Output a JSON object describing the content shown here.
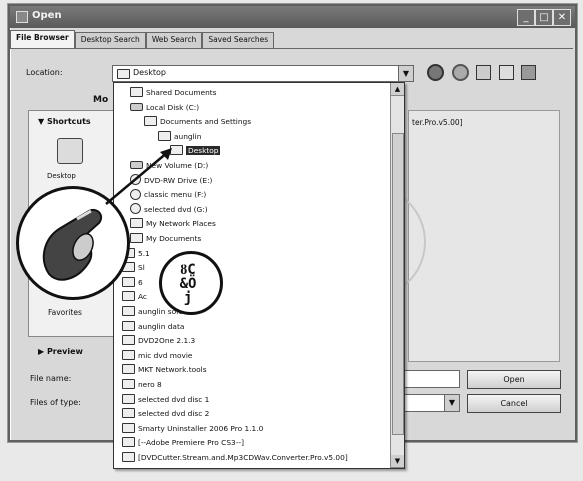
{
  "window": {
    "title": "Open",
    "buttons": [
      "minimize",
      "maximize",
      "close"
    ]
  },
  "tabs": [
    {
      "label": "File Browser",
      "active": true
    },
    {
      "label": "Desktop Search",
      "active": false
    },
    {
      "label": "Web Search",
      "active": false
    },
    {
      "label": "Saved Searches",
      "active": false
    }
  ],
  "location": {
    "label": "Location:",
    "value": "Desktop"
  },
  "left_pane": {
    "mode_label": "Mo",
    "shortcuts_header": "Shortcuts",
    "desktop_label": "Desktop",
    "favorites_label": "Favorites",
    "preview_header": "Preview"
  },
  "right_pane": {
    "partial_text": "ter.Pro.v5.00]"
  },
  "bottom": {
    "filename_label": "File name:",
    "filetype_label": "Files of type:",
    "open_button": "Open",
    "cancel_button": "Cancel"
  },
  "dropdown": {
    "items": [
      {
        "label": "Shared Documents",
        "icon": "folder-icon",
        "indent": 1,
        "selected": false
      },
      {
        "label": "Local Disk (C:)",
        "icon": "drive-icon",
        "indent": 1,
        "selected": false
      },
      {
        "label": "Documents and Settings",
        "icon": "folder-icon",
        "indent": 2,
        "selected": false
      },
      {
        "label": "aunglin",
        "icon": "folder-icon",
        "indent": 3,
        "selected": false
      },
      {
        "label": "Desktop",
        "icon": "folder-icon",
        "indent": 4,
        "selected": true
      },
      {
        "label": "New Volume (D:)",
        "icon": "drive-icon",
        "indent": 1,
        "selected": false
      },
      {
        "label": "DVD-RW Drive (E:)",
        "icon": "disc-icon",
        "indent": 1,
        "selected": false
      },
      {
        "label": "classic menu (F:)",
        "icon": "disc-icon",
        "indent": 1,
        "selected": false
      },
      {
        "label": "selected dvd (G:)",
        "icon": "disc-icon",
        "indent": 1,
        "selected": false
      },
      {
        "label": "My Network Places",
        "icon": "folder-icon",
        "indent": 1,
        "selected": false
      },
      {
        "label": "My Documents",
        "icon": "folder-icon",
        "indent": 1,
        "selected": false
      },
      {
        "label": "5.1",
        "icon": "folder-icon",
        "indent": 0,
        "selected": false
      },
      {
        "label": "Sl",
        "icon": "folder-icon",
        "indent": 0,
        "selected": false
      },
      {
        "label": "6",
        "icon": "folder-icon",
        "indent": 0,
        "selected": false
      },
      {
        "label": "Ac",
        "icon": "folder-icon",
        "indent": 0,
        "selected": false
      },
      {
        "label": "aunglin software",
        "icon": "folder-icon",
        "indent": 0,
        "selected": false
      },
      {
        "label": "aunglin data",
        "icon": "folder-icon",
        "indent": 0,
        "selected": false
      },
      {
        "label": "DVD2One 2.1.3",
        "icon": "folder-icon",
        "indent": 0,
        "selected": false
      },
      {
        "label": "mic dvd movie",
        "icon": "folder-icon",
        "indent": 0,
        "selected": false
      },
      {
        "label": "MKT Network.tools",
        "icon": "folder-icon",
        "indent": 0,
        "selected": false
      },
      {
        "label": "nero 8",
        "icon": "folder-icon",
        "indent": 0,
        "selected": false
      },
      {
        "label": "selected dvd disc 1",
        "icon": "folder-icon",
        "indent": 0,
        "selected": false
      },
      {
        "label": "selected dvd disc 2",
        "icon": "folder-icon",
        "indent": 0,
        "selected": false
      },
      {
        "label": "Smarty Uninstaller 2006 Pro 1.1.0",
        "icon": "folder-icon",
        "indent": 0,
        "selected": false
      },
      {
        "label": "[--Adobe Premiere Pro CS3--]",
        "icon": "folder-icon",
        "indent": 0,
        "selected": false
      },
      {
        "label": "[DVDCutter.Stream.and.Mp3CDWav.Converter.Pro.v5.00]",
        "icon": "folder-icon",
        "indent": 0,
        "selected": false
      }
    ]
  },
  "annotation": {
    "cursor_glyph": "ȣC\n&Ö\nj"
  }
}
